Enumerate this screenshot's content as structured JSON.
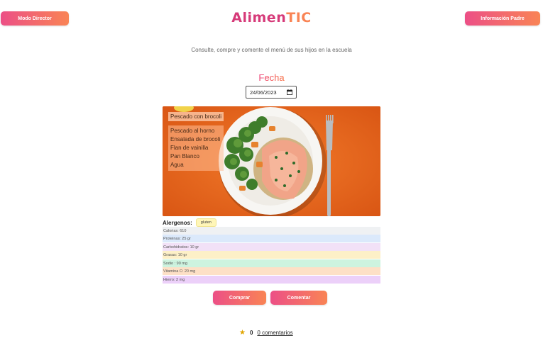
{
  "header": {
    "left_button": "Modo Director",
    "right_button": "Información Padre",
    "logo_part1": "Alimen",
    "logo_part2": "TIC",
    "subtitle": "Consulte, compre y comente el menú de sus hijos en la escuela"
  },
  "date": {
    "label": "Fecha",
    "value": "24/06/2023"
  },
  "menu": {
    "main_dish": "Pescado con brocoli",
    "items": [
      "Pescado al horno",
      "Ensalada de brocoli",
      "Flan de vainilla",
      "Pan Blanco",
      "Agua"
    ]
  },
  "allergens": {
    "label": "Alergenos:",
    "items": [
      "gluten"
    ]
  },
  "nutrition": [
    {
      "text": "Calorias: 610",
      "color": "#eff1f3"
    },
    {
      "text": "Proteinas: 25 gr",
      "color": "#dbe9fb"
    },
    {
      "text": "Carbohidratos: 10 gr",
      "color": "#f2e1f7"
    },
    {
      "text": "Grasas: 10 gr",
      "color": "#fdf0c7"
    },
    {
      "text": "Sodio : 90 mg",
      "color": "#cdf3df"
    },
    {
      "text": "Vitamina C: 20 mg",
      "color": "#fde0c6"
    },
    {
      "text": "Hierro: 2 mg",
      "color": "#ecd0f9"
    }
  ],
  "actions": {
    "buy": "Comprar",
    "comment": "Comentar"
  },
  "rating": {
    "score": "0",
    "comments_link": "0 comentarios"
  },
  "colors": {
    "gradient_start": "#ec4f86",
    "gradient_end": "#f98455",
    "photo_background": "#ee6a1f"
  }
}
